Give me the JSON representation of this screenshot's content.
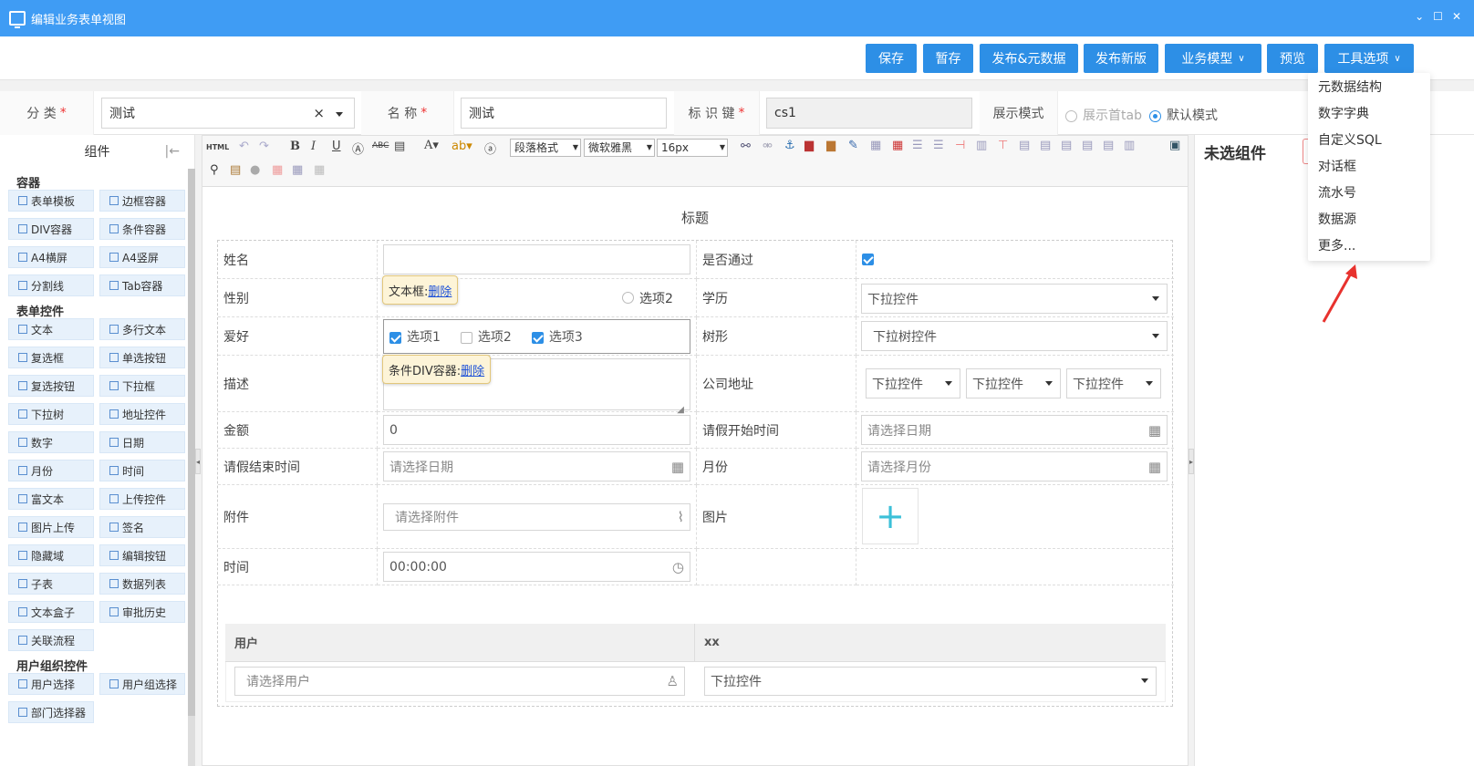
{
  "window": {
    "title": "编辑业务表单视图",
    "min": "⌄",
    "max": "☐",
    "close": "✕"
  },
  "toolbar": {
    "buttons": [
      "保存",
      "暂存",
      "发布&元数据",
      "发布新版",
      "业务模型",
      "预览",
      "工具选项"
    ]
  },
  "form": {
    "category_label": "分    类",
    "category_value": "测试",
    "name_label": "名    称",
    "name_value": "测试",
    "key_label": "标 识 键",
    "key_value": "cs1",
    "mode_label": "展示模式",
    "mode_opt1": "展示首tab",
    "mode_opt2": "默认模式",
    "required": "*",
    "clear": "×"
  },
  "left": {
    "title": "组件",
    "collapse": "|←",
    "groups": [
      {
        "title": "容器",
        "items": [
          "表单模板",
          "边框容器",
          "DIV容器",
          "条件容器",
          "A4横屏",
          "A4竖屏",
          "分割线",
          "Tab容器"
        ]
      },
      {
        "title": "表单控件",
        "items": [
          "文本",
          "多行文本",
          "复选框",
          "单选按钮",
          "复选按钮",
          "下拉框",
          "下拉树",
          "地址控件",
          "数字",
          "日期",
          "月份",
          "时间",
          "富文本",
          "上传控件",
          "图片上传",
          "签名",
          "隐藏域",
          "编辑按钮",
          "子表",
          "数据列表",
          "文本盒子",
          "审批历史",
          "关联流程"
        ]
      },
      {
        "title": "用户组织控件",
        "items": [
          "用户选择",
          "用户组选择",
          "部门选择器"
        ]
      }
    ]
  },
  "editor": {
    "html_label": "HTML",
    "para": "段落格式",
    "font": "微软雅黑",
    "size": "16px",
    "form_title": "标题",
    "rows": {
      "name": "姓名",
      "pass": "是否通过",
      "gender": "性别",
      "gender_opt2": "选项2",
      "edu": "学历",
      "hobby": "爱好",
      "hobby_opts": [
        "选项1",
        "选项2",
        "选项3"
      ],
      "tree": "树形",
      "desc": "描述",
      "address": "公司地址",
      "amount": "金额",
      "amount_value": "0",
      "leave_start": "请假开始时间",
      "leave_end": "请假结束时间",
      "month": "月份",
      "attach": "附件",
      "image": "图片",
      "time": "时间",
      "time_value": "00:00:00"
    },
    "placeholders": {
      "dropdown": "下拉控件",
      "dropdown_tree": "下拉树控件",
      "date": "请选择日期",
      "month": "请选择月份",
      "attach": "请选择附件",
      "user": "请选择用户"
    },
    "tips": {
      "textbox": "文本框:",
      "cond_div": "条件DIV容器:",
      "delete": "删除"
    },
    "subtable": {
      "col1": "用户",
      "col2": "xx"
    }
  },
  "right": {
    "title": "未选组件"
  },
  "menu": {
    "items": [
      "元数据结构",
      "数字字典",
      "自定义SQL",
      "对话框",
      "流水号",
      "数据源",
      "更多..."
    ]
  },
  "colors": {
    "title_bar": "#3f9cf4",
    "button": "#2d8fe6",
    "accent": "#2d8fe6",
    "arrow": "#e8322e"
  }
}
